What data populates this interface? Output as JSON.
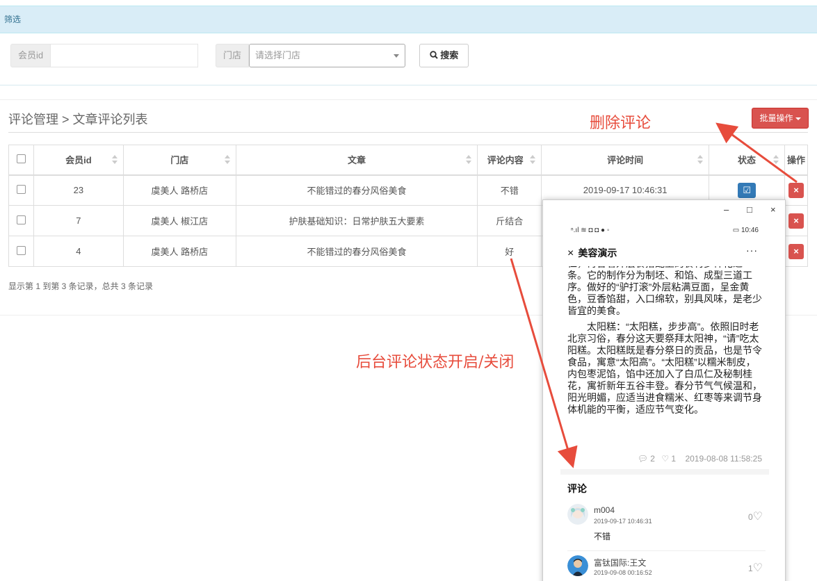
{
  "filter": {
    "header": "筛选",
    "member_id_label": "会员id",
    "member_id_value": "",
    "store_label": "门店",
    "store_placeholder": "请选择门店",
    "search_button": "搜索"
  },
  "breadcrumb": "评论管理 > 文章评论列表",
  "batch_button": "批量操作",
  "table": {
    "headers": [
      "会员id",
      "门店",
      "文章",
      "评论内容",
      "评论时间",
      "状态",
      "操作"
    ],
    "rows": [
      {
        "member_id": "23",
        "store": "虞美人 路桥店",
        "article": "不能错过的春分风俗美食",
        "content": "不错",
        "time": "2019-09-17 10:46:31"
      },
      {
        "member_id": "7",
        "store": "虞美人 椒江店",
        "article": "护肤基础知识：日常护肤五大要素",
        "content": "斤结合",
        "time": ""
      },
      {
        "member_id": "4",
        "store": "虞美人 路桥店",
        "article": "不能错过的春分风俗美食",
        "content": "好",
        "time": ""
      }
    ]
  },
  "page_info": "显示第 1 到第 3 条记录，总共 3 条记录",
  "annotations": {
    "delete": "删除评论",
    "status": "后台评论状态开启/关闭",
    "color": "#e74c3c"
  },
  "phone": {
    "win_min": "–",
    "win_max": "□",
    "win_close": "×",
    "status_icons": "ⁿ.ıl ≋ ◘ ◘ ● ◦",
    "status_time": "▭ 10:46",
    "nav_close": "×",
    "nav_title": "美容演示",
    "nav_more": "···",
    "article_paragraphs": [
      "仁，再合着外层食搭配上的食材多样化之一条。它的制作分为制坯、和馅、成型三道工序。做好的“驴打滚”外层粘满豆面，呈金黄色，豆香馅甜，入口绵软，别具风味，是老少皆宜的美食。",
      "　　太阳糕：“太阳糕，步步高”。依照旧时老北京习俗，春分这天要祭拜太阳神，“请”吃太阳糕。太阳糕既是春分祭日的贡品，也是节令食品，寓意“太阳高”。“太阳糕”以糯米制皮，内包枣泥馅，馅中还加入了白瓜仁及秘制桂花，寓祈新年五谷丰登。春分节气气候温和，阳光明媚，应适当进食糯米、红枣等来调节身体机能的平衡，适应节气变化。"
    ],
    "comment_count": "2",
    "like_count": "1",
    "publish_time": "2019-08-08 11:58:25",
    "comments_title": "评论",
    "comments": [
      {
        "name": "m004",
        "date": "2019-09-17 10:46:31",
        "text": "不错",
        "likes": "0"
      },
      {
        "name": "富钛国际:王文",
        "date": "2019-09-08 00:16:52",
        "text": "",
        "likes": "1"
      }
    ]
  }
}
